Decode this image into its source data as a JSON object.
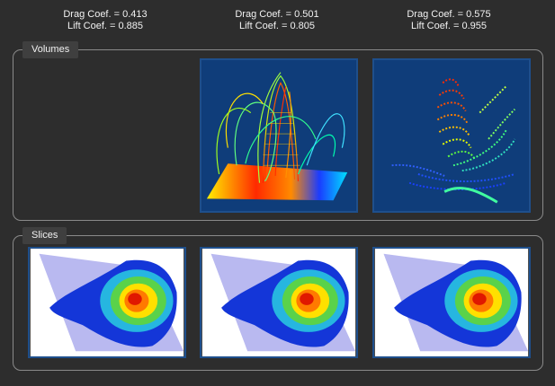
{
  "coefficients": [
    {
      "drag": "Drag Coef. = 0.413",
      "lift": "Lift Coef. = 0.885"
    },
    {
      "drag": "Drag Coef. = 0.501",
      "lift": "Lift Coef. = 0.805"
    },
    {
      "drag": "Drag Coef. = 0.575",
      "lift": "Lift Coef. = 0.955"
    }
  ],
  "volumes": {
    "title": "Volumes"
  },
  "slices": {
    "title": "Slices"
  },
  "colors": {
    "background": "#2d2d2d",
    "tile_border": "#1e4f8c",
    "volume_bg": "#0f3d7a",
    "slice_bg": "#ffffff",
    "slice_plane": "#b9b9f0"
  },
  "icons": {
    "volume_render_1": "streamline-volume-render",
    "volume_render_2": "particle-volume-render",
    "slice_render": "slice-plane-render"
  }
}
